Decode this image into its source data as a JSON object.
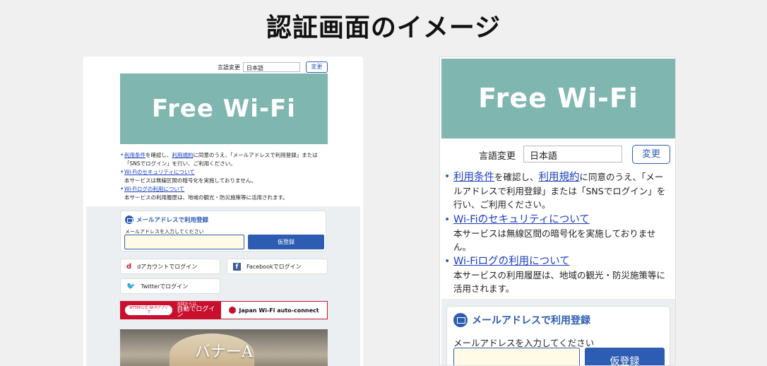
{
  "heading": "認証画面のイメージ",
  "desktop": {
    "language": {
      "label": "言語変更",
      "selected": "日本語",
      "button": "変更"
    },
    "banner": "Free Wi-Fi",
    "notes": {
      "item1_link1": "利用条件",
      "item1_text1": "を確認し、",
      "item1_link2": "利用規約",
      "item1_text2": "に同意のうえ、「メールアドレスで利用登録」または",
      "item1_text3": "「SNSでログイン」を行い、ご利用ください。",
      "item2_link": "Wi-Fiのセキュリティについて",
      "item2_text": "本サービスは無線区間の暗号化を実施しておりません。",
      "item3_link": "Wi-Fiログの利用について",
      "item3_text": "本サービスの利用履歴は、地域の観光・防災施策等に活用されます。"
    },
    "mail": {
      "title": "メールアドレスで利用登録",
      "hint": "メールアドレスを入力してください",
      "value": "",
      "button": "仮登録"
    },
    "social": {
      "d_label": "dアカウントでログイン",
      "facebook_label": "Facebookでログイン",
      "twitter_label": "Twitterでログイン"
    },
    "auto_connect": {
      "pill": "NTTBP公式 Wi-Fiアプリで",
      "small": "次回からは、",
      "big": "自動でログイン",
      "brand": "Japan Wi-Fi auto-connect"
    },
    "banner_a": "バナーA"
  },
  "mobile": {
    "banner": "Free Wi-Fi",
    "language": {
      "label": "言語変更",
      "selected": "日本語",
      "button": "変更"
    },
    "notes": {
      "item1_link1": "利用条件",
      "item1_text1": "を確認し、",
      "item1_link2": "利用規約",
      "item1_text2": "に同意のうえ、「メールアドレスで利用登録」または「SNSでログイン」を行い、ご利用ください。",
      "item2_link": "Wi-Fiのセキュリティについて",
      "item2_text": "本サービスは無線区間の暗号化を実施しておりません。",
      "item3_link": "Wi-Fiログの利用について",
      "item3_text": "本サービスの利用履歴は、地域の観光・防災施策等に活用されます。"
    },
    "mail": {
      "title": "メールアドレスで利用登録",
      "hint": "メールアドレスを入力してください",
      "value": "",
      "button": "仮登録"
    }
  },
  "colors": {
    "banner_bg": "#7fb6b0",
    "accent": "#2d5db3",
    "link": "#1a3ec1",
    "input_bg": "#fffbe6",
    "auto_red": "#c8102e"
  }
}
